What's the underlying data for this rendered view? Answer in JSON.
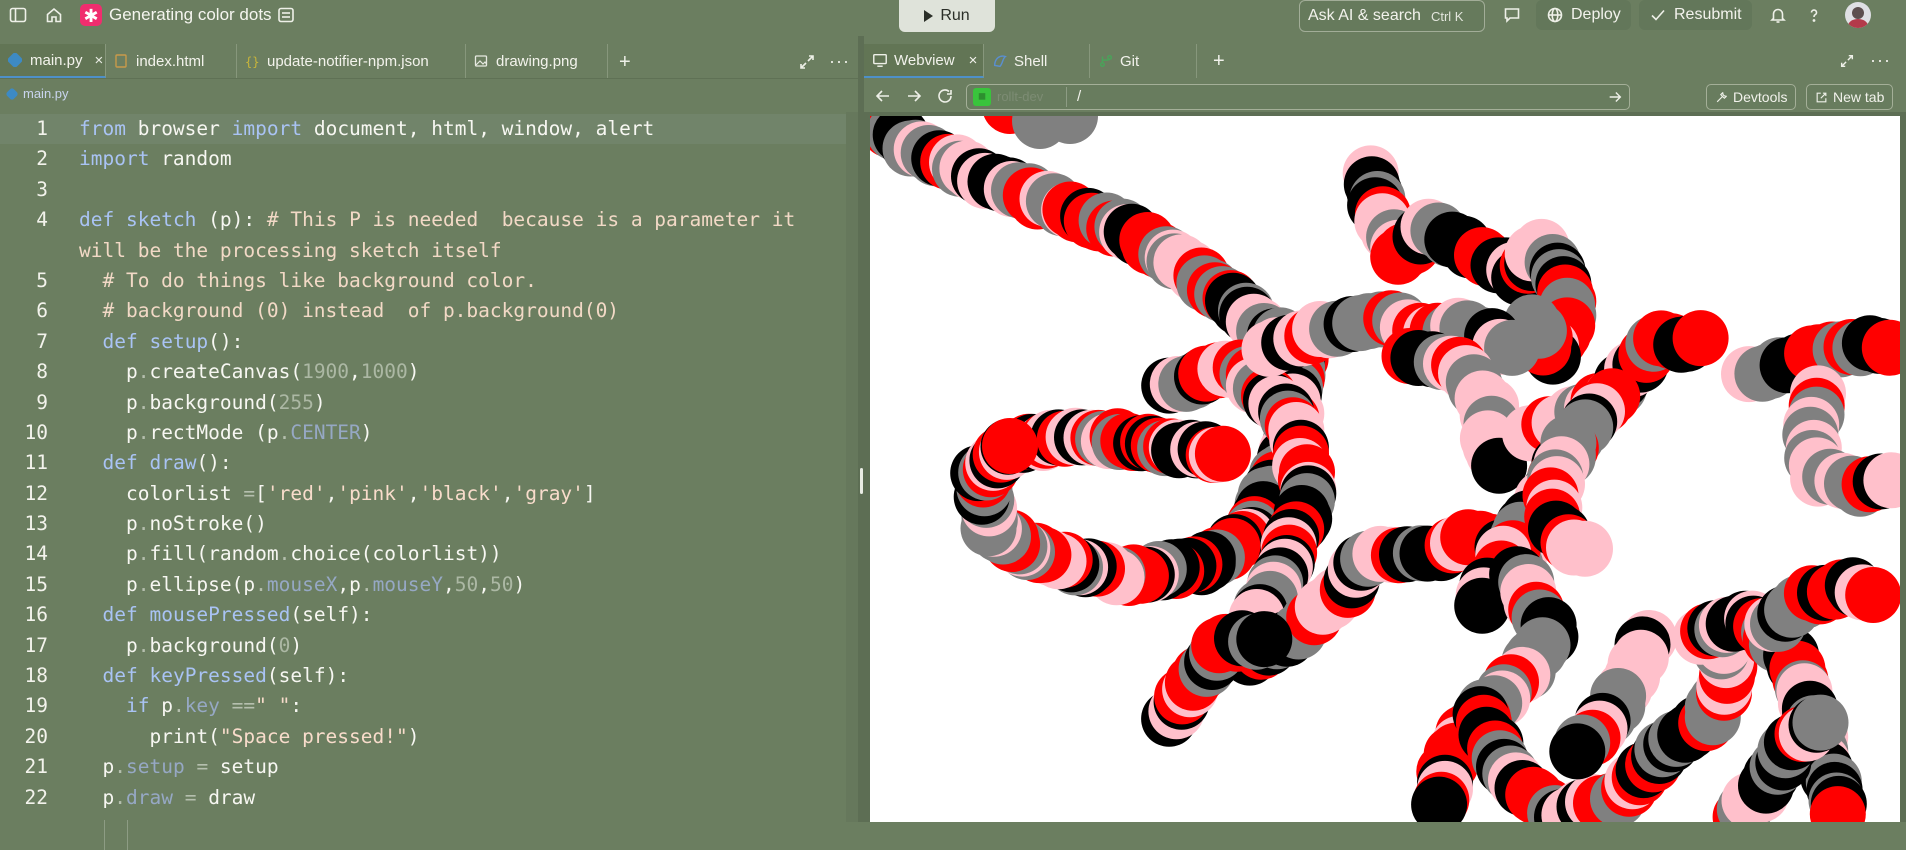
{
  "app": {
    "title": "Generating color dots"
  },
  "toolbar": {
    "run_label": "Run",
    "ask_ai_label": "Ask AI & search",
    "ask_ai_shortcut": "Ctrl  K",
    "deploy_label": "Deploy",
    "resubmit_label": "Resubmit"
  },
  "left_tabs": [
    {
      "label": "main.py",
      "icon": "python-file-icon",
      "close": "×"
    },
    {
      "label": "index.html",
      "icon": "html-file-icon"
    },
    {
      "label": "update-notifier-npm.json",
      "icon": "json-file-icon"
    },
    {
      "label": "drawing.png",
      "icon": "image-file-icon"
    }
  ],
  "breadcrumb": {
    "file": "main.py"
  },
  "right_tabs": [
    {
      "label": "Webview",
      "icon": "monitor-icon",
      "close": "×"
    },
    {
      "label": "Shell",
      "icon": "shell-icon"
    },
    {
      "label": "Git",
      "icon": "git-icon"
    }
  ],
  "webview": {
    "url_host": "rollt-dev",
    "url_path": "/",
    "devtools_label": "Devtools",
    "new_tab_label": "New tab"
  },
  "editor": {
    "line_numbers": [
      "1",
      "2",
      "3",
      "4",
      "5",
      "6",
      "7",
      "8",
      "9",
      "10",
      "11",
      "12",
      "13",
      "14",
      "15",
      "16",
      "17",
      "18",
      "19",
      "20",
      "21",
      "22"
    ]
  },
  "colors": {
    "accent": "#4e90c8",
    "run_bg": "#dfe3da",
    "dot_red": "#ff0000",
    "dot_pink": "#ffc0cb",
    "dot_black": "#000000",
    "dot_gray": "#808080"
  }
}
